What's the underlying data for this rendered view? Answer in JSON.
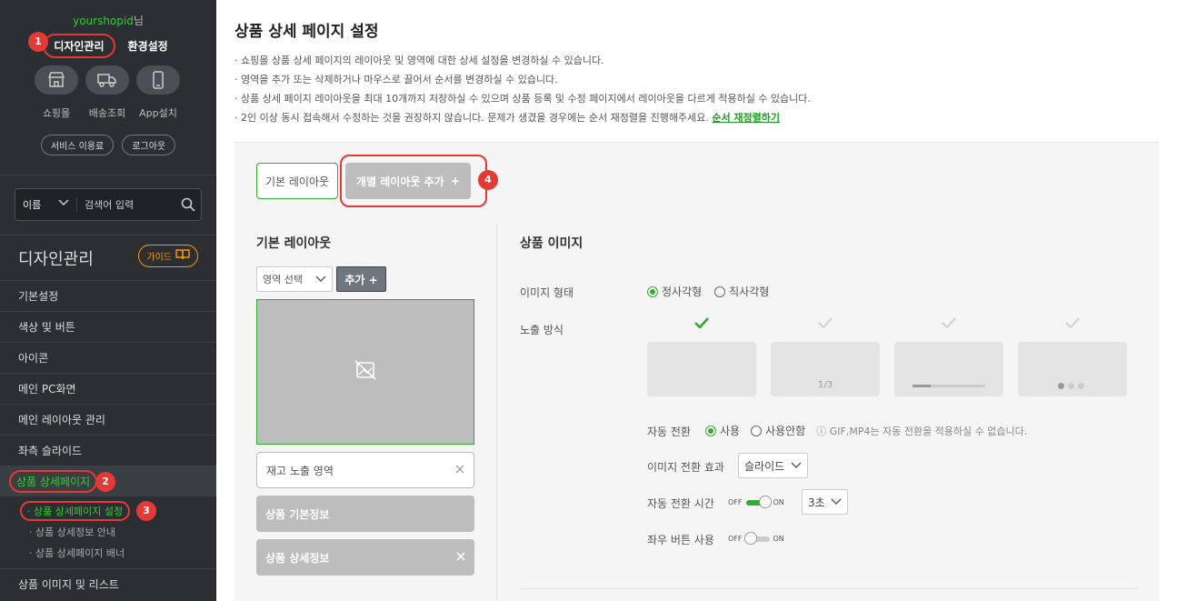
{
  "sidebar": {
    "user_id": "yourshopid",
    "user_suffix": "님",
    "top_tabs": {
      "design": "디자인관리",
      "settings": "환경설정"
    },
    "quick": [
      {
        "icon": "store-icon",
        "label": "쇼핑몰"
      },
      {
        "icon": "truck-icon",
        "label": "배송조회"
      },
      {
        "icon": "phone-icon",
        "label": "App설치"
      }
    ],
    "pills": {
      "terms": "서비스 이용료",
      "logout": "로그아웃"
    },
    "search": {
      "select": "이름",
      "placeholder": "검색어 입력"
    },
    "section_title": "디자인관리",
    "guide": "가이드",
    "menu": [
      "기본설정",
      "색상 및 버튼",
      "아이콘",
      "메인 PC화면",
      "메인 레이아웃 관리",
      "좌측 슬라이드",
      "상품 상세페이지"
    ],
    "sub_menu": [
      "· 상품 상세페이지 설정",
      "· 상품 상세정보 안내",
      "· 상품 상세페이지 배너"
    ],
    "last_menu": "상품 이미지 및 리스트",
    "markers": [
      "1",
      "2",
      "3",
      "4"
    ]
  },
  "main": {
    "title": "상품 상세 페이지 설정",
    "notes": [
      "· 쇼핑몰 상품 상세 페이지의 레이아웃 및 영역에 대한 상세 설정을 변경하실 수 있습니다.",
      "· 영역을 추가 또는 삭제하거나 마우스로 끌어서 순서를 변경하실 수 있습니다.",
      "· 상품 상세 페이지 레이아웃을 최대 10개까지 저장하실 수 있으며 상품 등록 및 수정 페이지에서 레이아웃을 다르게 적용하실 수 있습니다.",
      "·  2인 이상 동시 접속해서 수정하는 것을 권장하지 않습니다. 문제가 생겼을 경우에는 순서 재정렬을 진행해주세요. "
    ],
    "reorder_link": "순서 재정렬하기",
    "tabs": {
      "basic": "기본 레이아웃",
      "add": "개별 레이아웃 추가",
      "plus": "+"
    },
    "left": {
      "title": "기본 레이아웃",
      "region_select": "영역 선택",
      "add_button": "추가 +",
      "stock": "재고 노출 영역",
      "blocks": [
        "상품 기본정보",
        "상품 상세정보"
      ]
    },
    "right": {
      "title": "상품 이미지",
      "shape_label": "이미지 형태",
      "shape_options": [
        "정사각형",
        "직사각형"
      ],
      "display_label": "노출 방식",
      "counter": "1/3",
      "auto_label": "자동 전환",
      "auto_options": [
        "사용",
        "사용안함"
      ],
      "auto_hint": "ⓘ GIF,MP4는 자동 전환을 적용하실 수 없습니다.",
      "effect_label": "이미지 전환 효과",
      "effect_value": "슬라이드",
      "time_label": "자동 전환 시간",
      "time_value": "3초",
      "arrow_label": "좌우 버튼 사용",
      "off": "OFF",
      "on": "ON"
    }
  },
  "colors": {
    "accent": "#33aa33",
    "marker": "#e53935",
    "sidebar": "#2b2f33"
  }
}
